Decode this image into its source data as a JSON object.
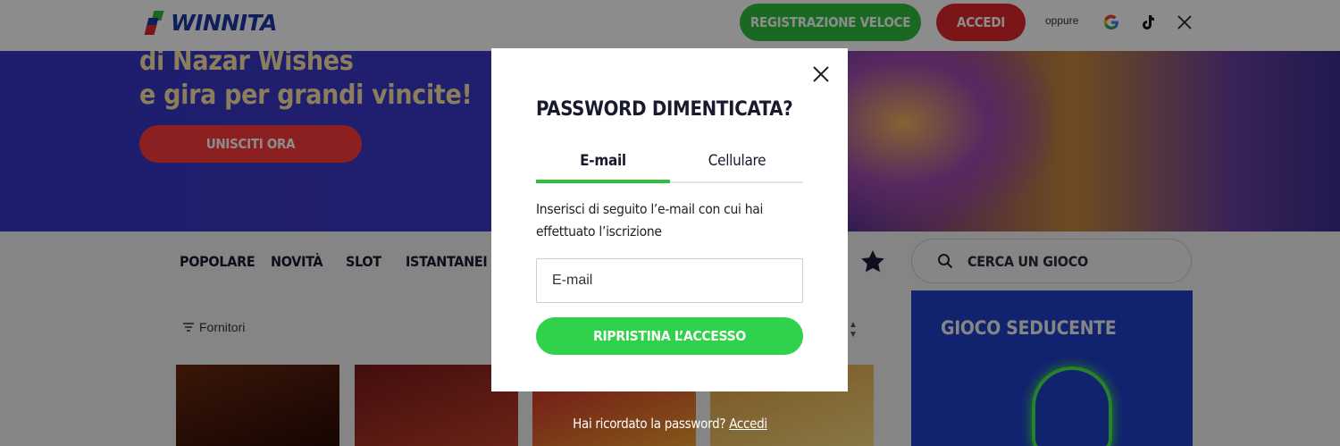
{
  "header": {
    "brand": "WINNITA",
    "register_label": "REGISTRAZIONE VELOCE",
    "login_label": "ACCEDI",
    "or_label": "oppure",
    "social_icons": [
      "google-icon",
      "tiktok-icon",
      "x-icon"
    ]
  },
  "hero": {
    "line1": "di Nazar Wishes",
    "line2": "e gira per grandi vincite!",
    "cta_label": "UNISCITI ORA"
  },
  "nav": {
    "items": [
      "POPOLARE",
      "NOVITÀ",
      "SLOT",
      "ISTANTANEI"
    ],
    "search_placeholder": "CERCA UN GIOCO",
    "providers_label": "Fornitori"
  },
  "promo": {
    "title": "GIOCO SEDUCENTE"
  },
  "modal": {
    "title": "PASSWORD DIMENTICATA?",
    "tabs": [
      {
        "label": "E-mail",
        "active": true
      },
      {
        "label": "Cellulare",
        "active": false
      }
    ],
    "description": "Inserisci di seguito l’e-mail con cui hai effettuato l’iscrizione",
    "email_placeholder": "E-mail",
    "email_value": "",
    "submit_label": "RIPRISTINA L’ACCESSO"
  },
  "footer_prompt": {
    "text": "Hai ricordato la password?",
    "link_label": "Accedi"
  },
  "colors": {
    "brand_blue": "#1b3aa8",
    "green": "#2ec040",
    "red": "#e0282c",
    "hero_bg": "#3a35c6"
  }
}
